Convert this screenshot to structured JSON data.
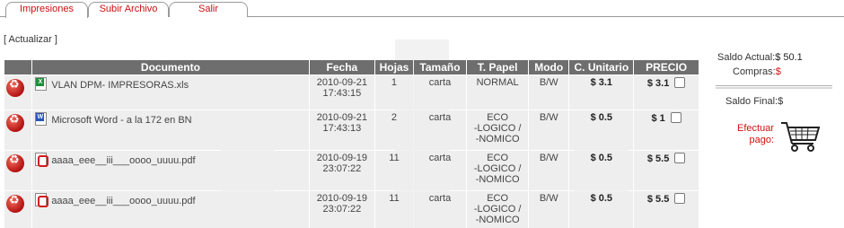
{
  "tabs": [
    {
      "label": "Impresiones"
    },
    {
      "label": "Subir Archivo"
    },
    {
      "label": "Salir"
    }
  ],
  "actions": {
    "refresh": "[ Actualizar ]"
  },
  "table": {
    "headers": [
      "Documento",
      "Fecha",
      "Hojas",
      "Tamaño",
      "T. Papel",
      "Modo",
      "C. Unitario",
      "PRECIO"
    ],
    "rows": [
      {
        "file_type": "xls",
        "name": "VLAN DPM- IMPRESORAS.xls",
        "date": "2010-09-21",
        "time": "17:43:15",
        "sheets": "1",
        "size": "carta",
        "paper": [
          "NORMAL"
        ],
        "mode": "B/W",
        "unit_cost": "$ 3.1",
        "price": "$ 3.1"
      },
      {
        "file_type": "doc",
        "name": "Microsoft Word - a la 172 en BN",
        "date": "2010-09-21",
        "time": "17:43:13",
        "sheets": "2",
        "size": "carta",
        "paper": [
          "ECO",
          "-LOGICO /",
          "-NOMICO"
        ],
        "mode": "B/W",
        "unit_cost": "$ 0.5",
        "price": "$ 1"
      },
      {
        "file_type": "pdf",
        "name": "aaaa_eee__iii___oooo_uuuu.pdf",
        "date": "2010-09-19",
        "time": "23:07:22",
        "sheets": "11",
        "size": "carta",
        "paper": [
          "ECO",
          "-LOGICO /",
          "-NOMICO"
        ],
        "mode": "B/W",
        "unit_cost": "$ 0.5",
        "price": "$ 5.5"
      },
      {
        "file_type": "pdf",
        "name": "aaaa_eee__iii___oooo_uuuu.pdf",
        "date": "2010-09-19",
        "time": "23:07:22",
        "sheets": "11",
        "size": "carta",
        "paper": [
          "ECO",
          "-LOGICO /",
          "-NOMICO"
        ],
        "mode": "B/W",
        "unit_cost": "$ 0.5",
        "price": "$ 5.5"
      }
    ]
  },
  "summary": {
    "saldo_actual_label": "Saldo Actual:",
    "saldo_actual_value": "$ 50.1",
    "compras_label": "Compras:",
    "compras_value": "$",
    "saldo_final_label": "Saldo Final:",
    "saldo_final_value": "$",
    "pay_line1": "Efectuar",
    "pay_line2": "pago:"
  },
  "icons": {
    "delete": "trash-recycle-icon",
    "cart": "shopping-cart-icon"
  }
}
